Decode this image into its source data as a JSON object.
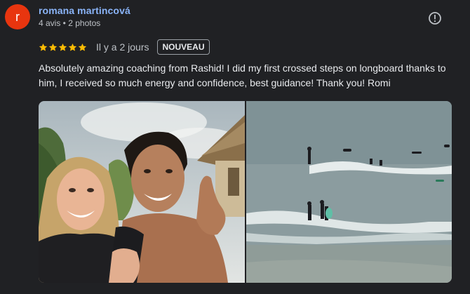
{
  "review": {
    "author": {
      "initial": "r",
      "name": "romana martincová",
      "meta": "4 avis • 2 photos",
      "avatar_color": "#e8350f"
    },
    "rating": 5,
    "star_color": "#fbbc04",
    "date": "Il y a 2 jours",
    "badge": "NOUVEAU",
    "text": "Absolutely amazing coaching from Rashid! I did my first crossed steps on longboard thanks to him, I received so much energy and confidence, best guidance! Thank you! Romi",
    "report_icon": "report-icon",
    "photos": [
      {
        "subject": "selfie-photo"
      },
      {
        "subject": "surf-beach-photo"
      }
    ]
  }
}
